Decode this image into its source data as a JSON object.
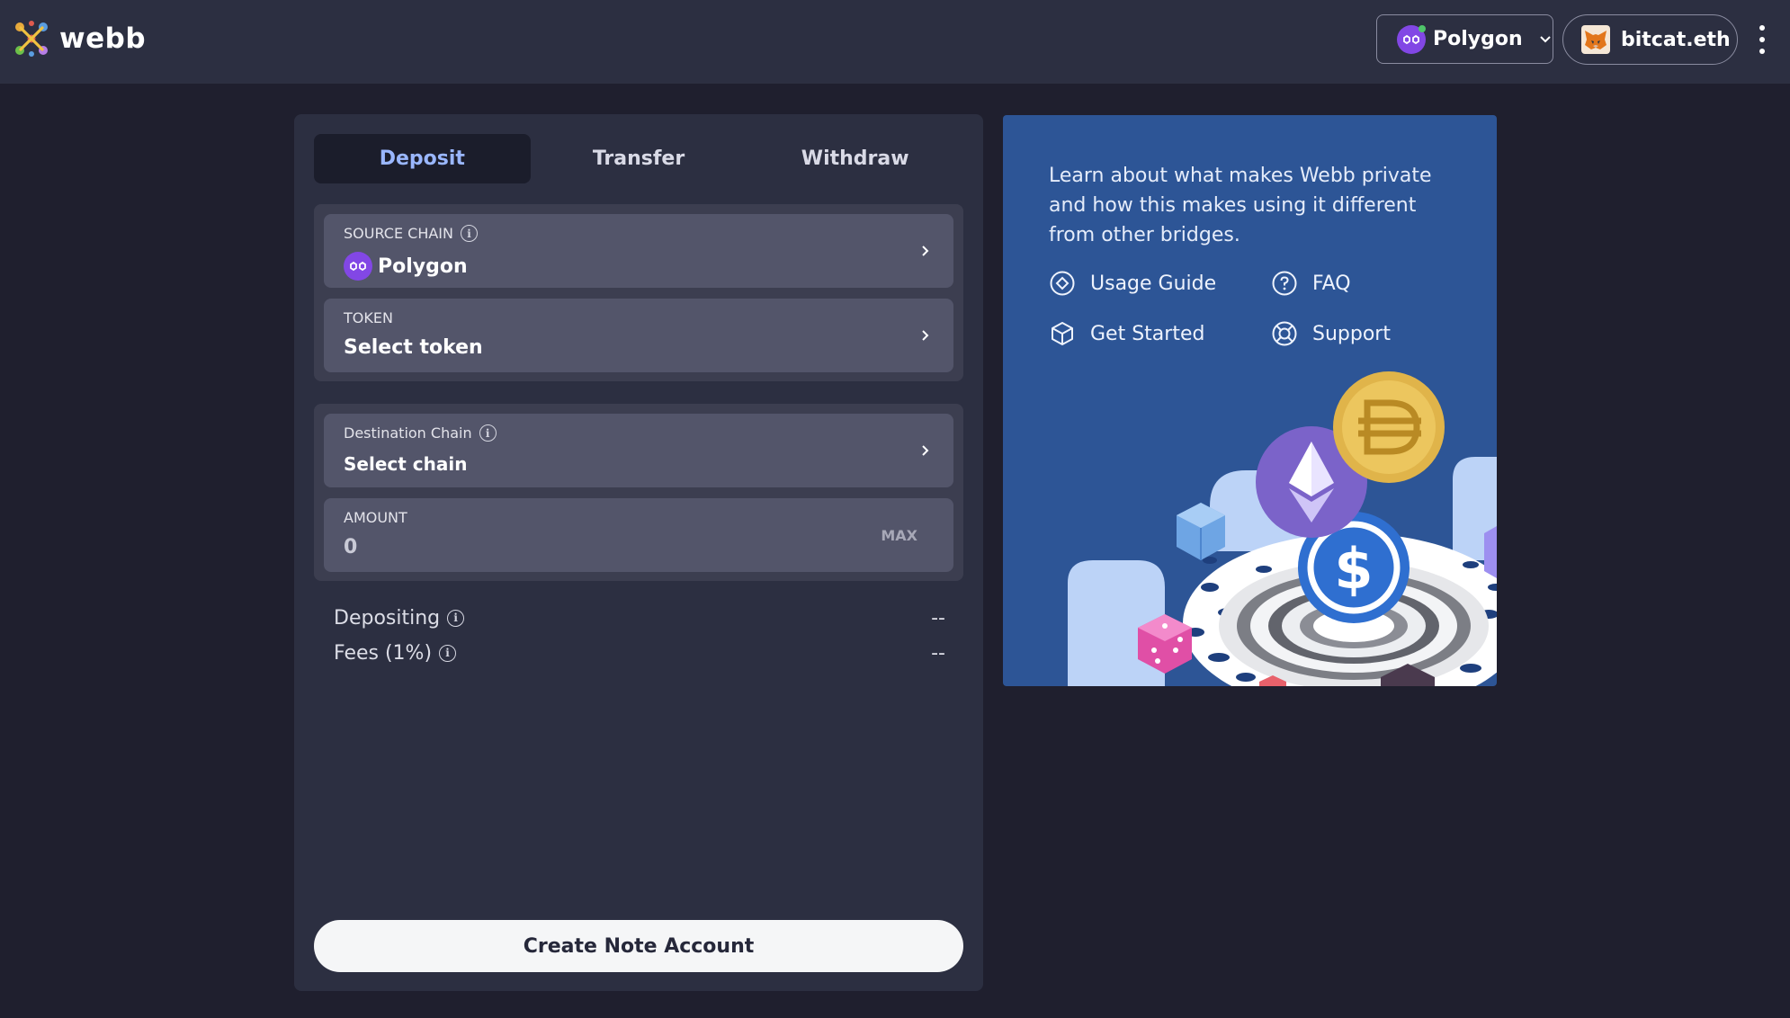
{
  "header": {
    "brand": "webb",
    "network": "Polygon",
    "wallet": "bitcat.eth"
  },
  "tabs": [
    {
      "label": "Deposit",
      "active": true
    },
    {
      "label": "Transfer",
      "active": false
    },
    {
      "label": "Withdraw",
      "active": false
    }
  ],
  "source": {
    "label": "SOURCE CHAIN",
    "value": "Polygon"
  },
  "token": {
    "label": "TOKEN",
    "value": "Select token"
  },
  "destination": {
    "label": "Destination Chain",
    "value": "Select chain"
  },
  "amount": {
    "label": "AMOUNT",
    "value": "0",
    "max_label": "MAX"
  },
  "summary": {
    "depositing_label": "Depositing",
    "depositing_value": "--",
    "fees_label": "Fees (1%)",
    "fees_value": "--"
  },
  "cta": "Create Note Account",
  "info": {
    "text": "Learn about what makes Webb private and how this makes using it different from other bridges.",
    "links": [
      "Usage Guide",
      "FAQ",
      "Get Started",
      "Support"
    ]
  },
  "colors": {
    "background": "#1f1f2e",
    "panel": "#2c2f41",
    "accent_tab": "#9ab7ff",
    "info_card": "#2d5596",
    "polygon_purple": "#8247e5"
  }
}
